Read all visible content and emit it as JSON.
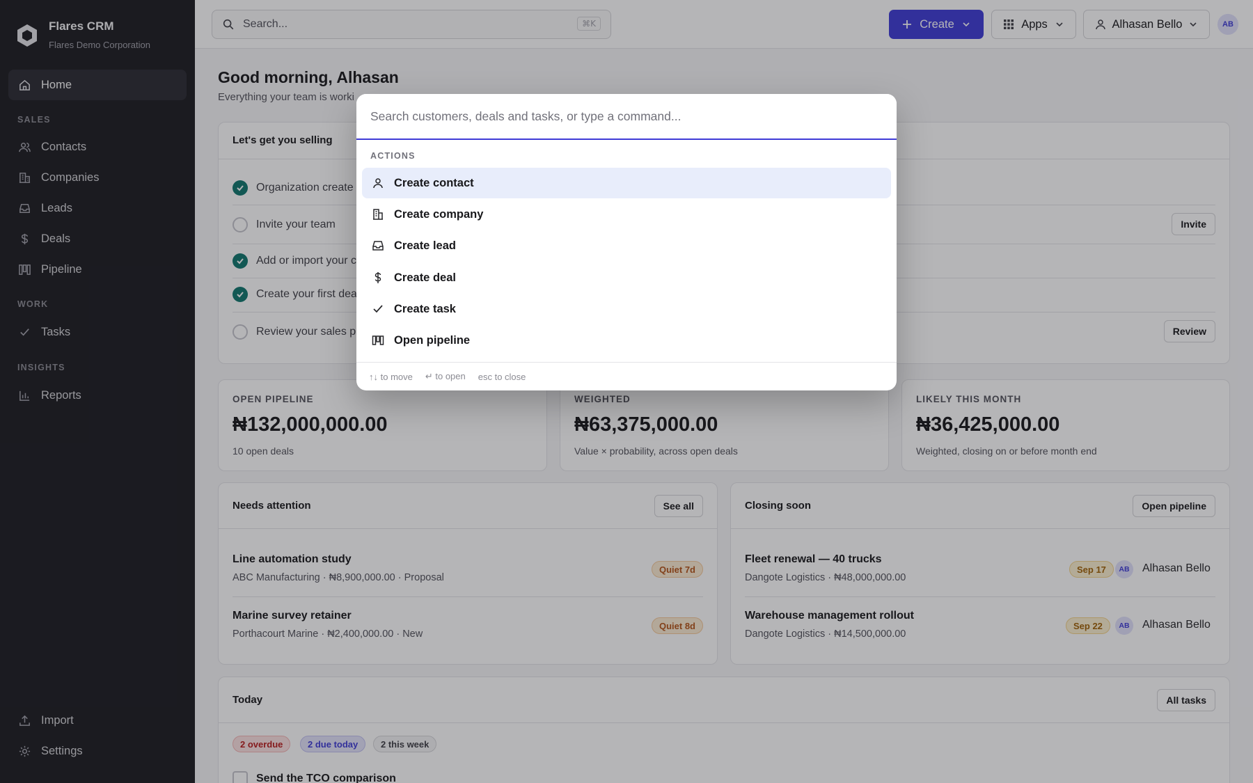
{
  "brand": {
    "name": "Flares CRM",
    "org": "Flares Demo Corporation"
  },
  "sidebar": {
    "home": "Home",
    "sections": {
      "sales": "SALES",
      "work": "WORK",
      "insights": "INSIGHTS"
    },
    "sales_items": [
      "Contacts",
      "Companies",
      "Leads",
      "Deals",
      "Pipeline"
    ],
    "work_items": [
      "Tasks"
    ],
    "insights_items": [
      "Reports"
    ],
    "bottom_items": [
      "Import",
      "Settings"
    ]
  },
  "topbar": {
    "search_placeholder": "Search...",
    "search_shortcut": "⌘K",
    "create_label": "Create",
    "apps_label": "Apps",
    "user_label": "Alhasan Bello",
    "user_initials": "AB"
  },
  "greeting": {
    "title": "Good morning, Alhasan",
    "subtitle": "Everything your team is worki"
  },
  "onboarding": {
    "title": "Let's get you selling",
    "items": [
      {
        "label": "Organization create",
        "done": true
      },
      {
        "label": "Invite your team",
        "done": false,
        "action": "Invite"
      },
      {
        "label": "Add or import your c",
        "done": true
      },
      {
        "label": "Create your first dea",
        "done": true
      },
      {
        "label": "Review your sales pi",
        "done": false,
        "action": "Review"
      }
    ]
  },
  "stats": [
    {
      "label": "OPEN PIPELINE",
      "value": "₦132,000,000.00",
      "sub": "10 open deals"
    },
    {
      "label": "WEIGHTED",
      "value": "₦63,375,000.00",
      "sub": "Value × probability, across open deals"
    },
    {
      "label": "LIKELY THIS MONTH",
      "value": "₦36,425,000.00",
      "sub": "Weighted, closing on or before month end"
    }
  ],
  "needs_attention": {
    "title": "Needs attention",
    "button": "See all",
    "rows": [
      {
        "name": "Line automation study",
        "meta": "ABC Manufacturing · ₦8,900,000.00 · Proposal",
        "badge": "Quiet 7d"
      },
      {
        "name": "Marine survey retainer",
        "meta": "Porthacourt Marine · ₦2,400,000.00 · New",
        "badge": "Quiet 8d"
      }
    ]
  },
  "closing_soon": {
    "title": "Closing soon",
    "button": "Open pipeline",
    "rows": [
      {
        "name": "Fleet renewal — 40 trucks",
        "meta": "Dangote Logistics · ₦48,000,000.00",
        "date": "Sep 17",
        "initials": "AB",
        "owner": "Alhasan Bello"
      },
      {
        "name": "Warehouse management rollout",
        "meta": "Dangote Logistics · ₦14,500,000.00",
        "date": "Sep 22",
        "initials": "AB",
        "owner": "Alhasan Bello"
      }
    ]
  },
  "today": {
    "title": "Today",
    "button": "All tasks",
    "filters": [
      "2 overdue",
      "2 due today",
      "2 this week"
    ],
    "first_task": "Send the TCO comparison"
  },
  "palette": {
    "placeholder": "Search customers, deals and tasks, or type a command...",
    "section": "ACTIONS",
    "commands": [
      "Create contact",
      "Create company",
      "Create lead",
      "Create deal",
      "Create task",
      "Open pipeline"
    ],
    "footer": [
      "↑↓ to move",
      "↵ to open",
      "esc to close"
    ]
  }
}
